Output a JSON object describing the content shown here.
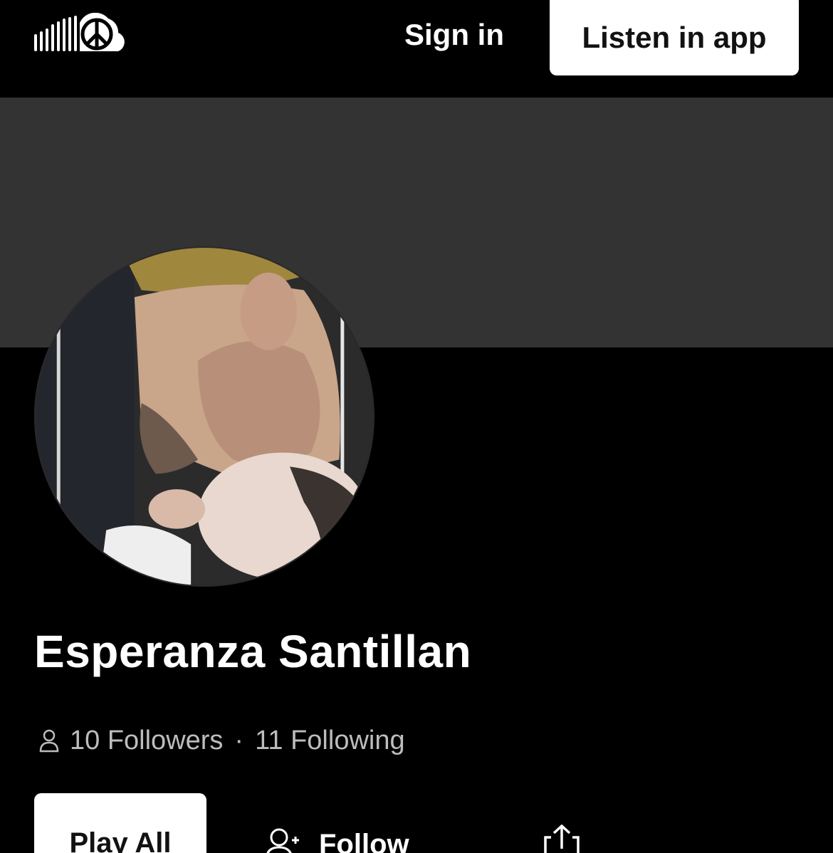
{
  "header": {
    "logo_icon": "soundcloud-peace-logo-icon",
    "signin_label": "Sign in",
    "listen_app_label": "Listen in app"
  },
  "profile": {
    "banner_color": "#333333",
    "avatar_alt": "profile photo",
    "name": "Esperanza Santillan",
    "followers_text": "10 Followers",
    "separator": "·",
    "following_text": "11 Following",
    "person_icon": "person-icon"
  },
  "actions": {
    "play_all_label": "Play All",
    "follow_label": "Follow",
    "follow_icon": "add-user-icon",
    "share_icon": "share-icon"
  },
  "colors": {
    "background": "#000000",
    "banner": "#333333",
    "button_bg": "#ffffff",
    "button_text": "#121212",
    "muted_text": "#bdbdbd"
  }
}
